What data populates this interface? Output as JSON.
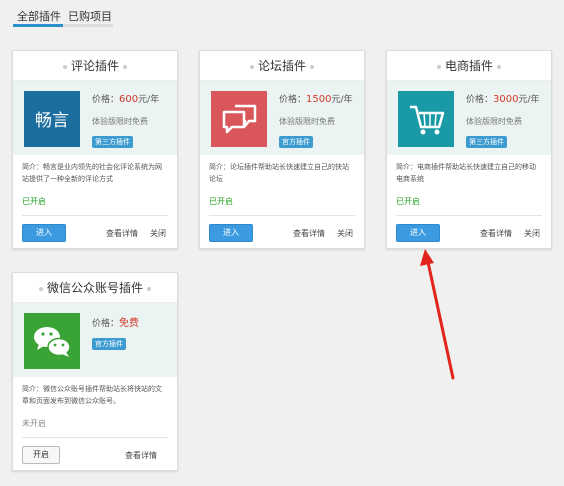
{
  "tabs": {
    "all": "全部插件",
    "purchased": "已购项目"
  },
  "common": {
    "trial": "体验版限时免费",
    "enter": "进入",
    "details": "查看详情",
    "close": "关闭",
    "open": "开启",
    "price_label": "价格："
  },
  "plugins": [
    {
      "title": "评论插件",
      "icon_text": "畅言",
      "price": "600",
      "price_unit": "元/年",
      "badge": "第三方插件",
      "desc": "简介：畅言是业内领先的社会化评论系统为网站提供了一种全新的评论方式",
      "status": "已开启"
    },
    {
      "title": "论坛插件",
      "price": "1500",
      "price_unit": "元/年",
      "badge": "官方插件",
      "desc": "简介：论坛插件帮助站长快速建立自己的快站论坛",
      "status": "已开启"
    },
    {
      "title": "电商插件",
      "price": "3000",
      "price_unit": "元/年",
      "badge": "第三方插件",
      "desc": "简介：电商插件帮助站长快速建立自己的移动电商系统",
      "status": "已开启"
    },
    {
      "title": "微信公众账号插件",
      "price": "免费",
      "badge": "官方插件",
      "desc": "简介：微信公众账号插件帮助站长将快站的文章和页面发布到微信公众账号。",
      "status": "未开启"
    }
  ],
  "colors": {
    "accent": "#3c9be0",
    "price": "#d03a27",
    "status_on": "#26a126",
    "arrow": "#e3241c",
    "icon_comment": "#1c6e9e",
    "icon_forum": "#d9575b",
    "icon_shop": "#1a9aa6",
    "icon_wechat": "#3aa336"
  },
  "icons": {
    "comment": "changyan-logo-icon",
    "forum": "chat-bubbles-icon",
    "shop": "shopping-cart-icon",
    "wechat": "wechat-icon"
  }
}
